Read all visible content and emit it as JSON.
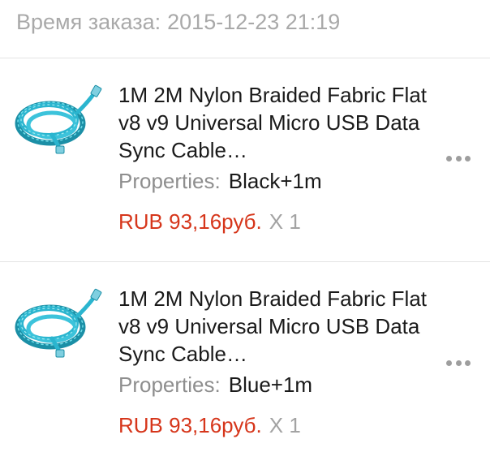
{
  "order": {
    "time_label": "Время заказа:",
    "time_value": "2015-12-23 21:19"
  },
  "items": [
    {
      "title": "1M 2M Nylon Braided Fabric Flat v8 v9 Universal Micro USB Data Sync Cable…",
      "properties_label": "Properties:",
      "properties_value": "Black+1m",
      "price": "RUB 93,16руб.",
      "quantity": "X 1",
      "thumbnail_icon": "cable-image",
      "menu_icon": "more-dots-icon"
    },
    {
      "title": "1M 2M Nylon Braided Fabric Flat v8 v9 Universal Micro USB Data Sync Cable…",
      "properties_label": "Properties:",
      "properties_value": "Blue+1m",
      "price": "RUB 93,16руб.",
      "quantity": "X 1",
      "thumbnail_icon": "cable-image",
      "menu_icon": "more-dots-icon"
    }
  ],
  "colors": {
    "price": "#d6361b",
    "muted": "#a9a9a9",
    "cable": "#2bb5cf"
  }
}
